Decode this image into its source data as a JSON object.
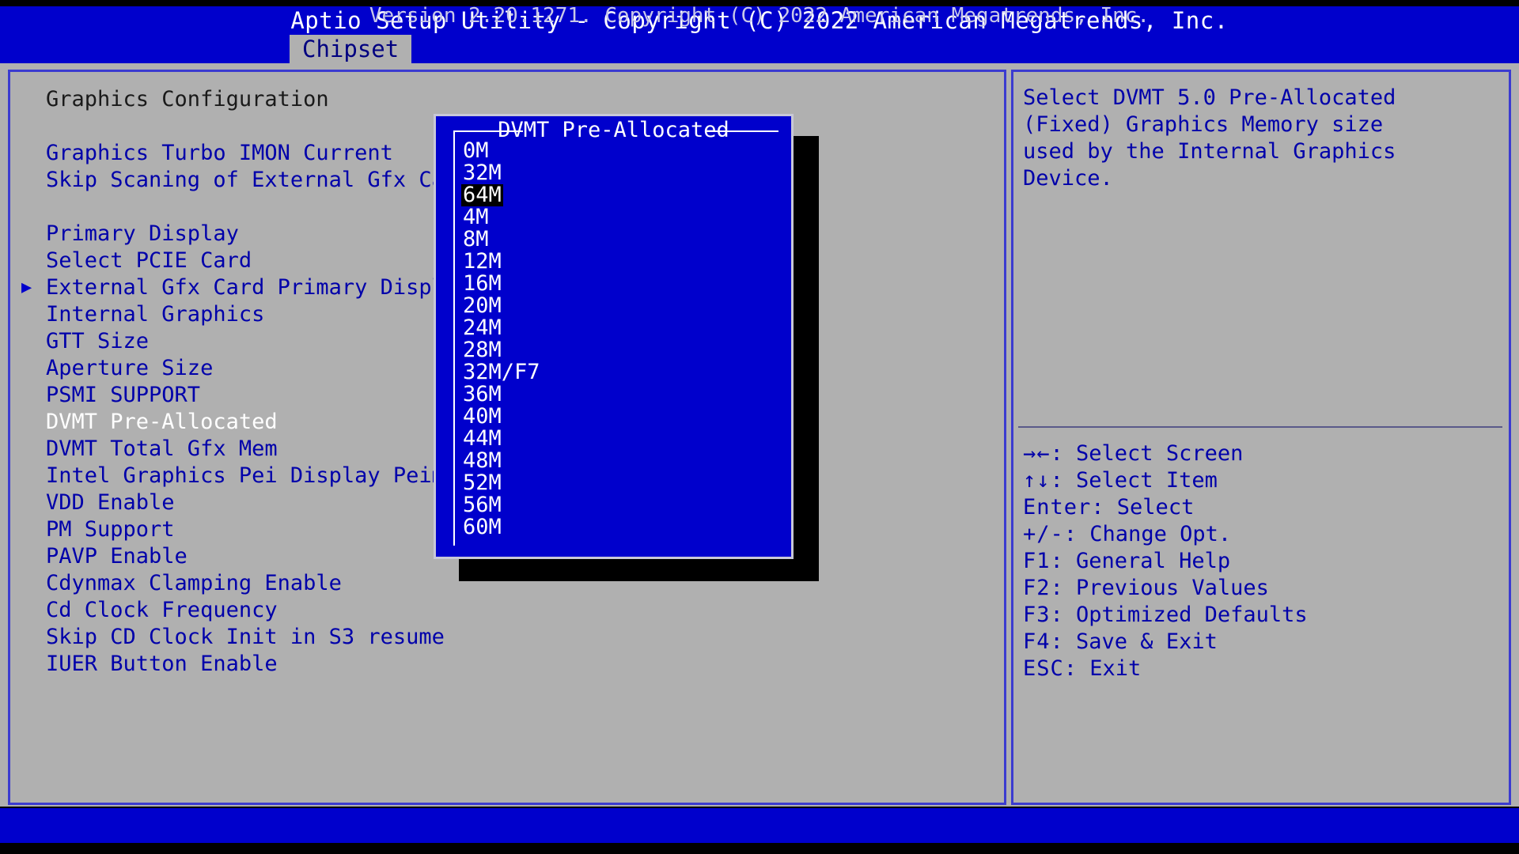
{
  "header": {
    "title": "Aptio Setup Utility - Copyright (C) 2022 American Megatrends, Inc.",
    "tab": "Chipset"
  },
  "left_panel": {
    "rows": [
      {
        "label": "Graphics Configuration",
        "style": "heading",
        "arrow": false
      },
      {
        "label": "",
        "style": "spacer",
        "arrow": false
      },
      {
        "label": "Graphics Turbo IMON Current",
        "style": "normal",
        "arrow": false
      },
      {
        "label": "Skip Scaning of External Gfx Card",
        "style": "normal",
        "arrow": false
      },
      {
        "label": "",
        "style": "spacer",
        "arrow": false
      },
      {
        "label": "Primary Display",
        "style": "normal",
        "arrow": false
      },
      {
        "label": "Select PCIE Card",
        "style": "normal",
        "arrow": false
      },
      {
        "label": "External Gfx Card Primary Display",
        "style": "normal",
        "arrow": true
      },
      {
        "label": "Internal Graphics",
        "style": "normal",
        "arrow": false
      },
      {
        "label": "GTT Size",
        "style": "normal",
        "arrow": false
      },
      {
        "label": "Aperture Size",
        "style": "normal",
        "arrow": false
      },
      {
        "label": "PSMI SUPPORT",
        "style": "normal",
        "arrow": false
      },
      {
        "label": "DVMT Pre-Allocated",
        "style": "selected",
        "arrow": false
      },
      {
        "label": "DVMT Total Gfx Mem",
        "style": "normal",
        "arrow": false
      },
      {
        "label": "Intel Graphics Pei Display Peim",
        "style": "normal",
        "arrow": false
      },
      {
        "label": "VDD Enable",
        "style": "normal",
        "arrow": false
      },
      {
        "label": "PM Support",
        "style": "normal",
        "arrow": false
      },
      {
        "label": "PAVP Enable",
        "style": "normal",
        "arrow": false
      },
      {
        "label": "Cdynmax Clamping Enable",
        "style": "normal",
        "arrow": false
      },
      {
        "label": "Cd Clock Frequency",
        "style": "normal",
        "arrow": false
      },
      {
        "label": "Skip CD Clock Init in S3 resume",
        "style": "normal",
        "arrow": false
      },
      {
        "label": "IUER Button Enable",
        "style": "normal",
        "arrow": false
      }
    ]
  },
  "right_panel": {
    "help_lines": [
      "Select DVMT 5.0 Pre-Allocated",
      "(Fixed) Graphics Memory size",
      "used by the Internal Graphics",
      "Device."
    ],
    "legend": [
      {
        "key": "→←",
        "text": ": Select Screen"
      },
      {
        "key": "↑↓",
        "text": ": Select Item"
      },
      {
        "key": "Enter",
        "text": ": Select"
      },
      {
        "key": "+/-",
        "text": ": Change Opt."
      },
      {
        "key": "F1",
        "text": ": General Help"
      },
      {
        "key": "F2",
        "text": ": Previous Values"
      },
      {
        "key": "F3",
        "text": ": Optimized Defaults"
      },
      {
        "key": "F4",
        "text": ": Save & Exit"
      },
      {
        "key": "ESC",
        "text": ": Exit"
      }
    ]
  },
  "popup": {
    "title": "DVMT Pre-Allocated",
    "selected_value": "64M",
    "options": [
      "0M",
      "32M",
      "64M",
      "4M",
      "8M",
      "12M",
      "16M",
      "20M",
      "24M",
      "28M",
      "32M/F7",
      "36M",
      "40M",
      "44M",
      "48M",
      "52M",
      "56M",
      "60M"
    ]
  },
  "footer": {
    "text": "Version 2.20.1271. Copyright (C) 2022 American Megatrends, Inc."
  },
  "colors": {
    "bios_blue": "#0000cc",
    "panel_gray": "#b0b0b0",
    "text_blue": "#0000aa",
    "highlight_white": "#ffffff",
    "selection_black": "#000000"
  }
}
